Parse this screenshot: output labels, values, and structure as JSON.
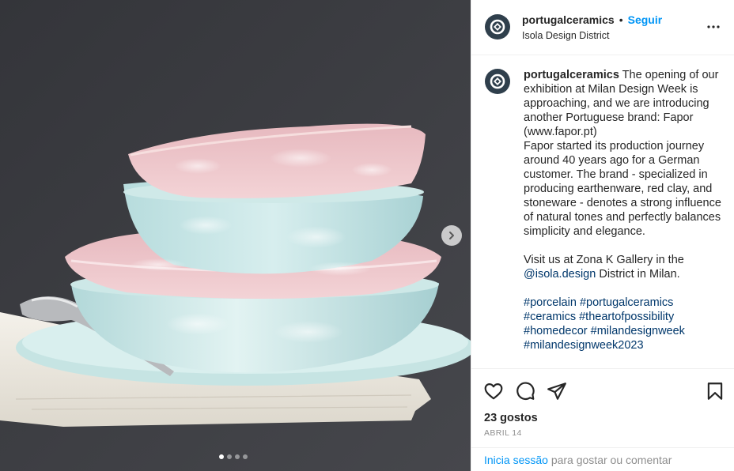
{
  "post": {
    "username": "portugalceramics",
    "follow_label": "Seguir",
    "separator": "•",
    "location": "Isola Design District",
    "caption": {
      "lines": [
        "The opening of our exhibition at Milan Design Week is approaching, and we are introducing another Portuguese brand: Fapor (www.fapor.pt)",
        "Fapor started its production journey around 40 years ago for a German customer. The brand - specialized in producing earthenware, red clay, and stoneware - denotes a strong influence of natural tones and perfectly balances simplicity and elegance."
      ],
      "visit_before": "Visit us at Zona K Gallery in the ",
      "mention": "@isola.design",
      "visit_after": " District in Milan.",
      "hashtags": [
        "#porcelain",
        "#portugalceramics",
        "#ceramics",
        "#theartofpossibility",
        "#homedecor",
        "#milandesignweek",
        "#milandesignweek2023"
      ]
    },
    "likes": "23 gostos",
    "date": "ABRIL 14",
    "login_link": "Inicia sessão",
    "login_rest": " para gostar ou comentar"
  },
  "carousel": {
    "slides": 4,
    "active_index": 0
  },
  "icons": {
    "more": "more-dots-icon",
    "like": "heart-icon",
    "comment": "comment-bubble-icon",
    "share": "paper-plane-icon",
    "save": "bookmark-icon",
    "next": "chevron-right-icon",
    "avatar": "brand-logo-icon"
  },
  "colors": {
    "follow": "#0095f6",
    "link": "#00376b",
    "muted": "#8e8e8e",
    "avatar_bg": "#2f3f4c",
    "photo_bg": "#3c3d42"
  }
}
